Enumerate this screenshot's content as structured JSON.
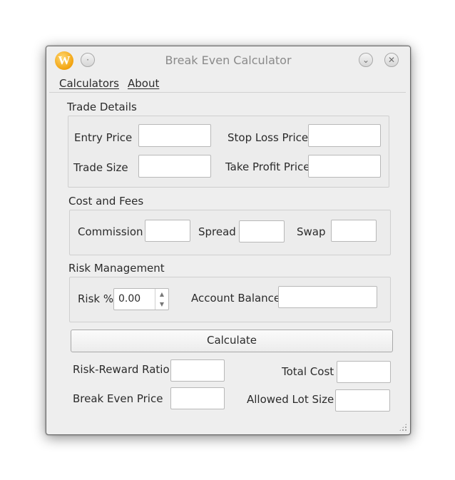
{
  "window": {
    "title": "Break Even Calculator",
    "icon": "app-logo-w",
    "logo_letter": "W"
  },
  "menu": {
    "items": [
      "Calculators",
      "About"
    ]
  },
  "trade_details": {
    "title": "Trade Details",
    "entry_price_label": "Entry Price",
    "stop_loss_label": "Stop Loss Price",
    "trade_size_label": "Trade Size",
    "take_profit_label": "Take Profit Price"
  },
  "cost_fees": {
    "title": "Cost and Fees",
    "commission_label": "Commission",
    "spread_label": "Spread",
    "swap_label": "Swap"
  },
  "risk": {
    "title": "Risk Management",
    "risk_label": "Risk %",
    "risk_value": "0.00",
    "balance_label": "Account Balance"
  },
  "actions": {
    "calculate_label": "Calculate"
  },
  "results": {
    "rr_label": "Risk-Reward Ratio",
    "total_cost_label": "Total Cost",
    "break_even_label": "Break Even Price",
    "lot_size_label": "Allowed Lot Size"
  },
  "colors": {
    "window_bg": "#eeeeee",
    "icon_orange": "#f2a30f"
  }
}
